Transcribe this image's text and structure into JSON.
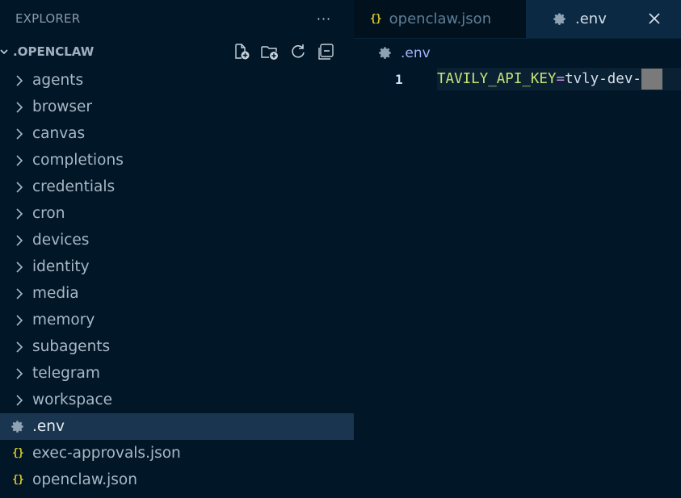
{
  "explorer": {
    "title": "EXPLORER",
    "more_actions": "···",
    "root_label": ".OPENCLAW",
    "tree": [
      {
        "type": "folder",
        "label": "agents"
      },
      {
        "type": "folder",
        "label": "browser"
      },
      {
        "type": "folder",
        "label": "canvas"
      },
      {
        "type": "folder",
        "label": "completions"
      },
      {
        "type": "folder",
        "label": "credentials"
      },
      {
        "type": "folder",
        "label": "cron"
      },
      {
        "type": "folder",
        "label": "devices"
      },
      {
        "type": "folder",
        "label": "identity"
      },
      {
        "type": "folder",
        "label": "media"
      },
      {
        "type": "folder",
        "label": "memory"
      },
      {
        "type": "folder",
        "label": "subagents"
      },
      {
        "type": "folder",
        "label": "telegram"
      },
      {
        "type": "folder",
        "label": "workspace"
      },
      {
        "type": "file",
        "icon": "gear-icon",
        "label": ".env",
        "selected": true
      },
      {
        "type": "file",
        "icon": "json-icon",
        "label": "exec-approvals.json"
      },
      {
        "type": "file",
        "icon": "json-icon",
        "label": "openclaw.json"
      }
    ]
  },
  "tabs": [
    {
      "label": "openclaw.json",
      "icon": "json-icon",
      "active": false
    },
    {
      "label": ".env",
      "icon": "gear-icon",
      "active": true
    }
  ],
  "json_icon_glyph": "{}",
  "breadcrumb": {
    "label": ".env"
  },
  "editor": {
    "line_number": "1",
    "key": "TAVILY_API_KEY",
    "equals": "=",
    "value": "tvly-dev-"
  },
  "colors": {
    "background": "#011627",
    "selected_row": "#1a3550",
    "json_icon": "#d4c72a",
    "env_key": "#c5e478",
    "env_equals": "#c792ea"
  }
}
